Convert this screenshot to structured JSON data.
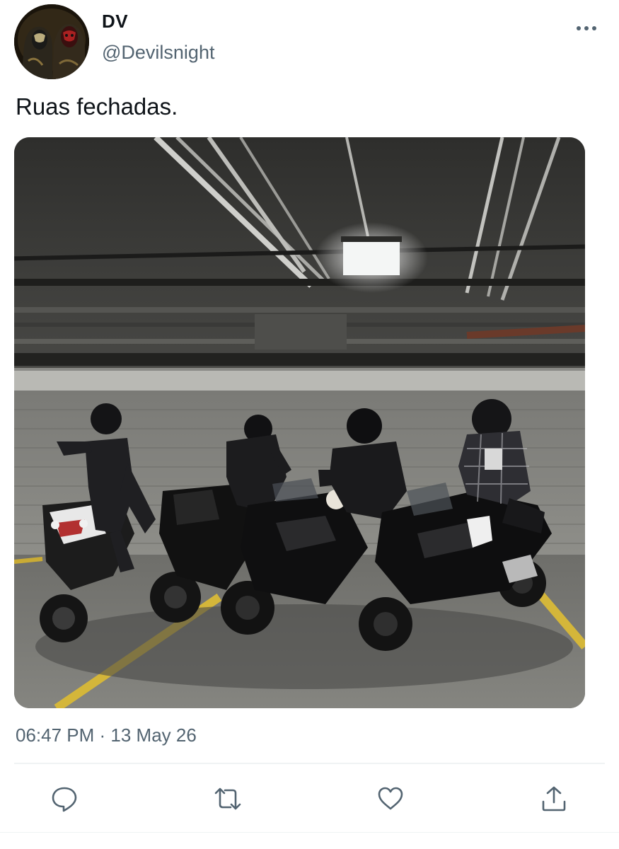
{
  "author": {
    "display_name": "DV",
    "handle": "@Devilsnight",
    "avatar_icon": "avatar-image"
  },
  "tweet": {
    "text": "Ruas fechadas.",
    "timestamp": "06:47 PM · 13 May 26"
  },
  "media": {
    "alt": "motorcycles-in-parking-garage-photo"
  },
  "actions": [
    {
      "name": "reply",
      "icon": "speech-bubble-icon"
    },
    {
      "name": "retweet",
      "icon": "retweet-arrows-icon"
    },
    {
      "name": "like",
      "icon": "heart-icon"
    },
    {
      "name": "share",
      "icon": "share-upload-icon"
    }
  ],
  "colors": {
    "text_primary": "#0f1419",
    "text_secondary": "#536471",
    "icon": "#536471",
    "divider": "#eff3f4"
  }
}
